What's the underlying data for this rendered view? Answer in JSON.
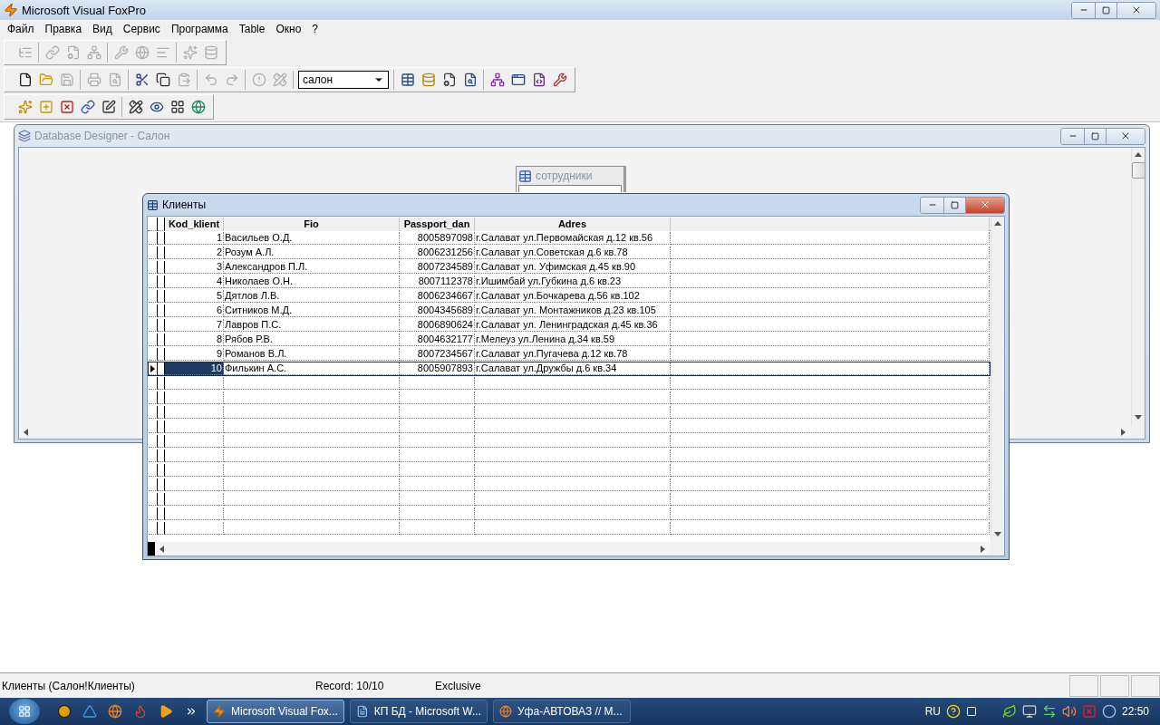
{
  "app": {
    "title": "Microsoft Visual FoxPro"
  },
  "menu": [
    "Файл",
    "Правка",
    "Вид",
    "Сервис",
    "Программа",
    "Table",
    "Окно",
    "?"
  ],
  "toolbars": [
    {
      "groups": [
        [
          {
            "kind": "tree",
            "disabled": true
          }
        ],
        [
          {
            "kind": "link",
            "disabled": true
          },
          {
            "kind": "properties",
            "disabled": true
          },
          {
            "kind": "network",
            "disabled": true
          }
        ],
        [
          {
            "kind": "tools",
            "disabled": true
          },
          {
            "kind": "globe",
            "disabled": true
          },
          {
            "kind": "align",
            "disabled": true
          }
        ],
        [
          {
            "kind": "sparkles",
            "disabled": true
          },
          {
            "kind": "database",
            "disabled": true
          }
        ]
      ]
    },
    {
      "groups": [
        [
          {
            "kind": "new",
            "disabled": false
          },
          {
            "kind": "open",
            "disabled": false
          },
          {
            "kind": "save",
            "disabled": true
          }
        ],
        [
          {
            "kind": "print",
            "disabled": true
          },
          {
            "kind": "preview",
            "disabled": true
          }
        ],
        [
          {
            "kind": "cut",
            "disabled": false
          },
          {
            "kind": "copy",
            "disabled": false
          },
          {
            "kind": "paste",
            "disabled": true
          }
        ],
        [
          {
            "kind": "undo",
            "disabled": true
          },
          {
            "kind": "redo",
            "disabled": true
          }
        ],
        [
          {
            "kind": "run",
            "disabled": true
          },
          {
            "kind": "modify",
            "disabled": true
          }
        ],
        [
          {
            "kind": "combo",
            "value": "салон"
          }
        ],
        [
          {
            "kind": "table",
            "disabled": false
          },
          {
            "kind": "database",
            "disabled": false
          },
          {
            "kind": "properties",
            "disabled": false
          },
          {
            "kind": "preview",
            "disabled": false
          }
        ],
        [
          {
            "kind": "network",
            "disabled": false
          },
          {
            "kind": "form",
            "disabled": false
          },
          {
            "kind": "code",
            "disabled": false
          },
          {
            "kind": "tools",
            "disabled": false
          }
        ]
      ]
    },
    {
      "groups": [
        [
          {
            "kind": "sparkles",
            "disabled": false
          },
          {
            "kind": "add",
            "disabled": false
          },
          {
            "kind": "remove",
            "disabled": false
          },
          {
            "kind": "link",
            "disabled": false
          },
          {
            "kind": "edit",
            "disabled": false
          }
        ],
        [
          {
            "kind": "modify",
            "disabled": false
          },
          {
            "kind": "view",
            "disabled": false
          },
          {
            "kind": "grid",
            "disabled": false
          },
          {
            "kind": "globe",
            "disabled": false
          }
        ]
      ]
    }
  ],
  "designer": {
    "title": "Database Designer - Салон",
    "tables": [
      {
        "name": "сотрудники"
      }
    ]
  },
  "browse": {
    "title": "Клиенты",
    "columns": [
      "Kod_klient",
      "Fio",
      "Passport_dan",
      "Adres"
    ],
    "rows": [
      {
        "cells": [
          "1",
          "Васильев О.Д.",
          "8005897098",
          "г.Салават ул.Первомайская д.12 кв.56"
        ],
        "selected": false
      },
      {
        "cells": [
          "2",
          "Розум А.Л.",
          "8006231256",
          "г.Салават ул.Советская д.6 кв.78"
        ],
        "selected": false
      },
      {
        "cells": [
          "3",
          "Александров П.Л.",
          "8007234589",
          "г.Салават ул. Уфимская д.45 кв.90"
        ],
        "selected": false
      },
      {
        "cells": [
          "4",
          "Николаев О.Н.",
          "8007112378",
          "г.Ишимбай ул.Губкина д.6 кв.23"
        ],
        "selected": false
      },
      {
        "cells": [
          "5",
          "Дятлов Л.В.",
          "8006234667",
          "г.Салават ул.Бочкарева д.56 кв.102"
        ],
        "selected": false
      },
      {
        "cells": [
          "6",
          "Ситников М.Д.",
          "8004345689",
          "г.Салават ул. Монтажников д.23 кв.105"
        ],
        "selected": false
      },
      {
        "cells": [
          "7",
          "Лавров П.С.",
          "8006890624",
          "г.Салават ул. Ленинградская д.45 кв.36"
        ],
        "selected": false
      },
      {
        "cells": [
          "8",
          "Рябов Р.В.",
          "8004632177",
          "г.Мелеуз ул.Ленина д.34 кв.59"
        ],
        "selected": false
      },
      {
        "cells": [
          "9",
          "Романов В.Л.",
          "8007234567",
          "г.Салават ул.Пугачева д.12 кв.78"
        ],
        "selected": false
      },
      {
        "cells": [
          "10",
          "Филькин А.С.",
          "8005907893",
          "г.Салават ул.Дружбы д.6 кв.34"
        ],
        "selected": true
      }
    ]
  },
  "status_bar": {
    "alias": "Клиенты (Салон!Клиенты)",
    "record": "Record: 10/10",
    "mode": "Exclusive"
  },
  "taskbar": {
    "tasks": [
      {
        "label": "Microsoft Visual Fox...",
        "selected": true
      },
      {
        "label": "КП БД - Microsoft W...",
        "selected": false
      },
      {
        "label": "Уфа-АВТОВАЗ // М...",
        "selected": false
      }
    ],
    "language": "RU",
    "time": "22:50"
  }
}
